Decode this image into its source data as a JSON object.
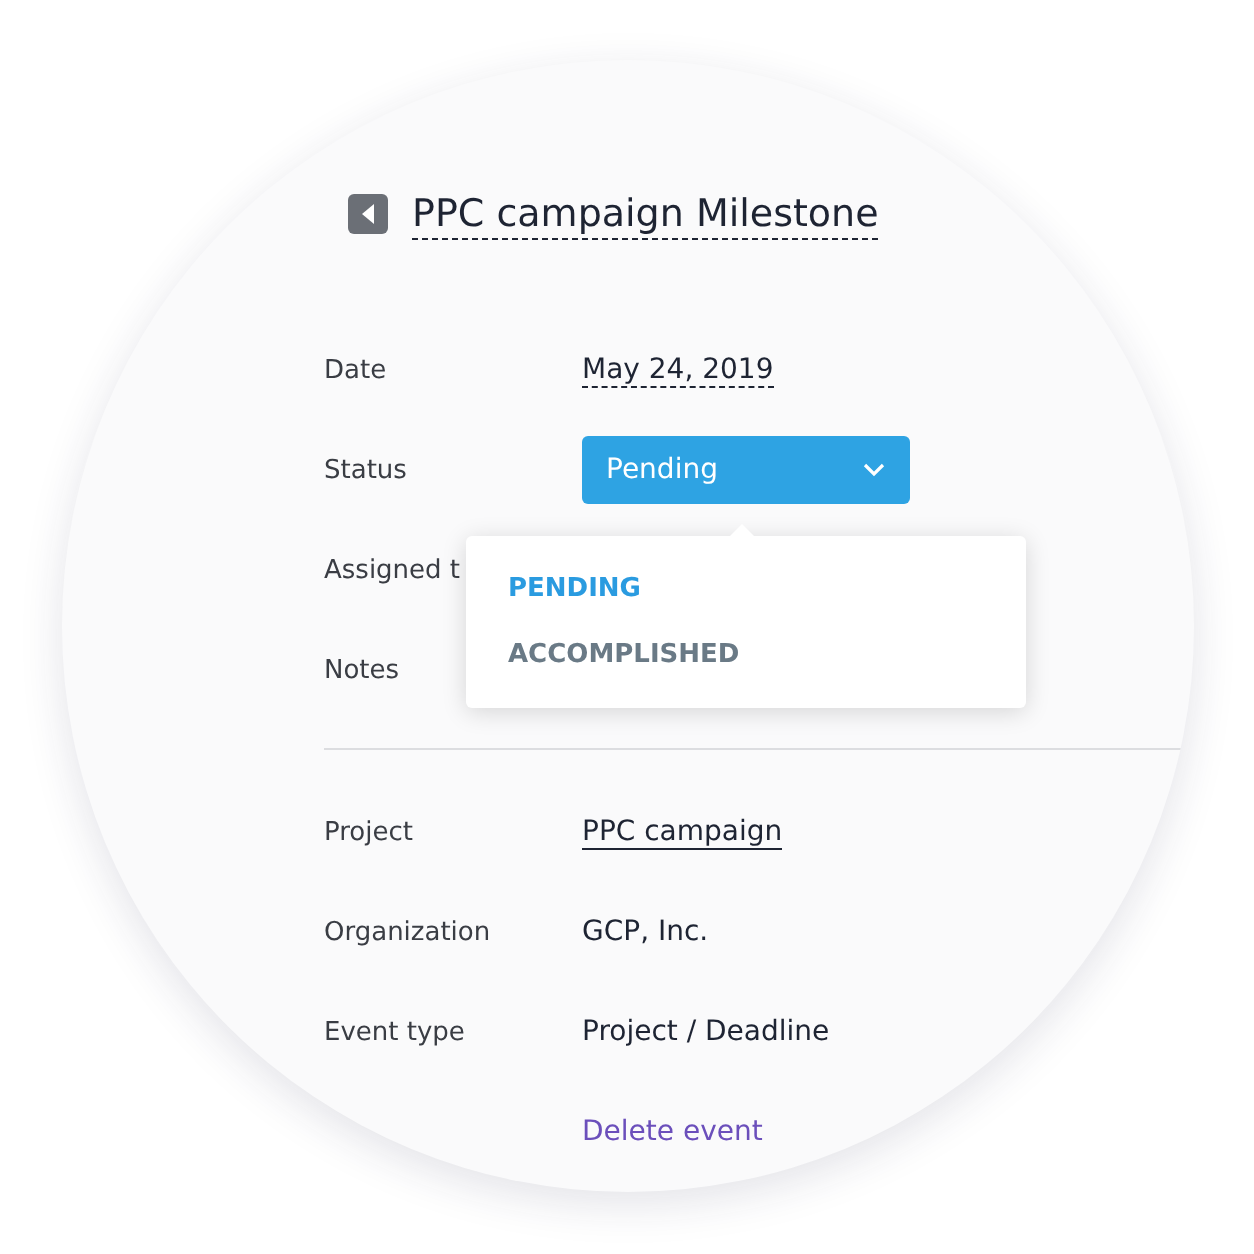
{
  "title": "PPC campaign Milestone",
  "fields": [
    {
      "label": "Date",
      "kind": "date",
      "value": "May 24, 2019"
    },
    {
      "label": "Status",
      "kind": "select",
      "value": "Pending"
    },
    {
      "label": "Assigned t",
      "kind": "covered"
    },
    {
      "label": "Notes",
      "kind": "covered"
    }
  ],
  "status_menu": {
    "options": [
      {
        "label": "PENDING",
        "selected": true
      },
      {
        "label": "ACCOMPLISHED",
        "selected": false
      }
    ]
  },
  "details": [
    {
      "label": "Project",
      "kind": "link",
      "value": "PPC campaign"
    },
    {
      "label": "Organization",
      "kind": "text",
      "value": "GCP, Inc."
    },
    {
      "label": "Event type",
      "kind": "text",
      "value": "Project / Deadline"
    }
  ],
  "delete_link": "Delete event"
}
